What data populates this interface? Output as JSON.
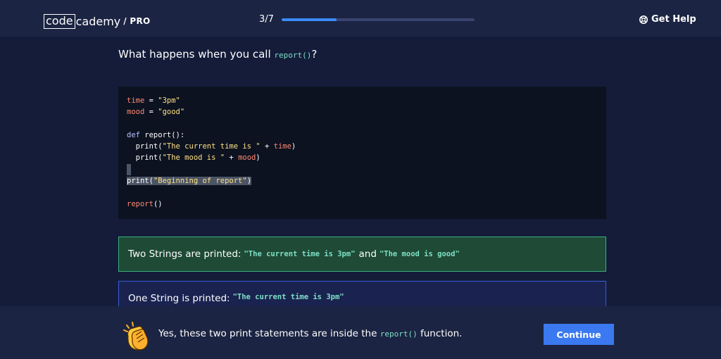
{
  "header": {
    "logo_code": "code",
    "logo_rest": "cademy",
    "logo_pro": "/ PRO",
    "progress_text": "3/7",
    "progress_fraction": 0.285,
    "help_label": "Get Help",
    "help_icon": "lifebuoy-icon"
  },
  "question": {
    "prefix": "What happens when you call ",
    "code": "report()",
    "suffix": "?"
  },
  "code": {
    "l1_var": "time",
    "l1_eq": " = ",
    "l1_str": "\"3pm\"",
    "l2_var": "mood",
    "l2_eq": " = ",
    "l2_str": "\"good\"",
    "l4_def": "def",
    "l4_rest": " report():",
    "l5_a": "  print(",
    "l5_str": "\"The current time is \"",
    "l5_plus": " + ",
    "l5_var": "time",
    "l5_close": ")",
    "l6_a": "  print(",
    "l6_str": "\"The mood is \"",
    "l6_plus": " + ",
    "l6_var": "mood",
    "l6_close": ")",
    "l8_a": "print(",
    "l8_str": "\"Beginning of report\"",
    "l8_close": ")",
    "l10_call": "report",
    "l10_rest": "()"
  },
  "answers": [
    {
      "text": "Two Strings are printed:",
      "code1": "\"The current time is 3pm\"",
      "joiner": "and",
      "code2": "\"The mood is good\""
    },
    {
      "text": "One String is printed:",
      "code1": "\"The current time is 3pm\""
    }
  ],
  "feedback": {
    "icon": "clapping-hands-icon",
    "prefix": "Yes, these two print statements are inside the ",
    "code": "report()",
    "suffix": " function.",
    "continue_label": "Continue"
  },
  "colors": {
    "background": "#141c3a",
    "bar": "#1b2442",
    "accent": "#3a79f0",
    "correct_bg": "#1e4a36",
    "correct_border": "#3bb07a",
    "code_green": "#7ee0c6"
  }
}
